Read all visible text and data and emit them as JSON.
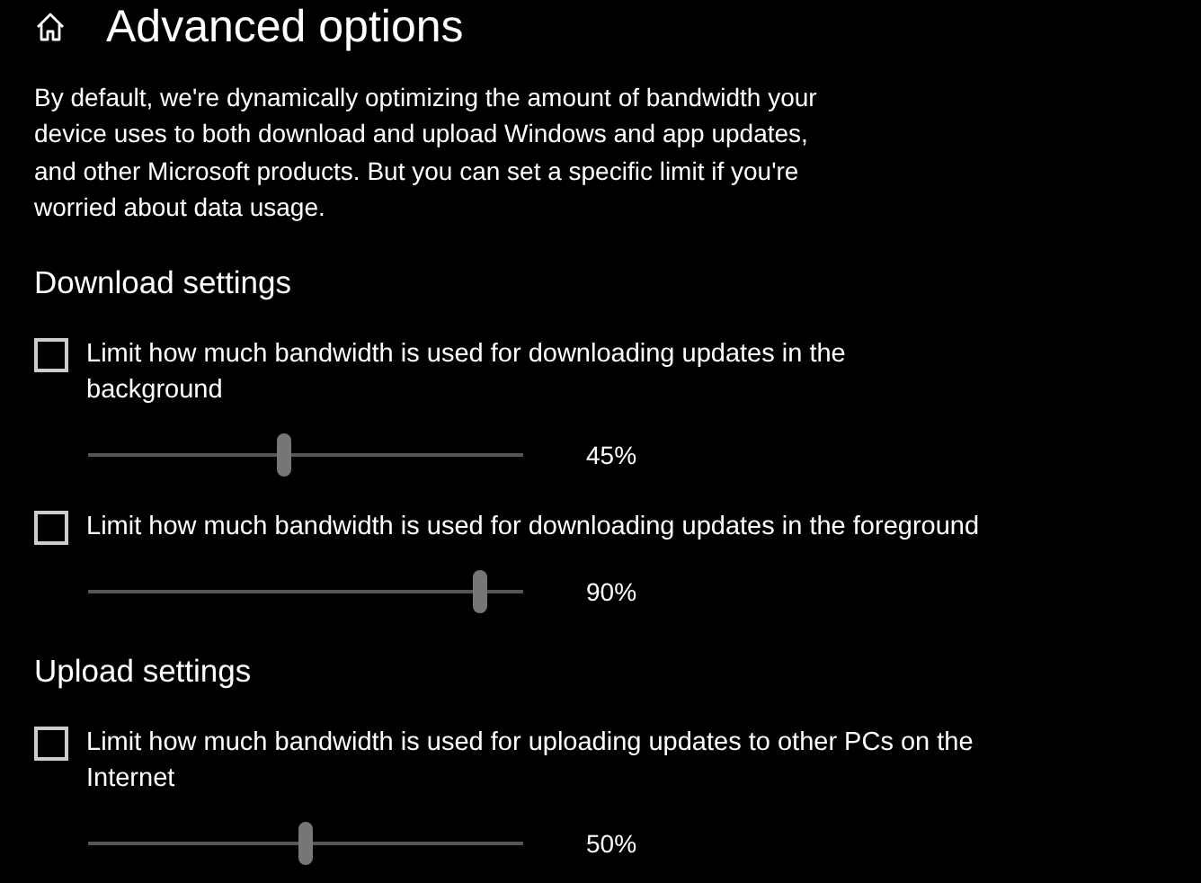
{
  "page": {
    "title": "Advanced options",
    "description": "By default, we're dynamically optimizing the amount of bandwidth your device uses to both download and upload Windows and app updates, and other Microsoft products. But you can set a specific limit if you're worried about data usage."
  },
  "sections": [
    {
      "heading": "Download settings",
      "options": [
        {
          "label": "Limit how much bandwidth is used for downloading updates in the background",
          "checked": false,
          "level": 0.45,
          "reading": "45%"
        },
        {
          "label": "Limit how much bandwidth is used for downloading updates in the foreground",
          "checked": false,
          "level": 0.9,
          "reading": "90%"
        }
      ]
    },
    {
      "heading": "Upload settings",
      "options": [
        {
          "label": "Limit how much bandwidth is used for uploading updates to other PCs on the Internet",
          "checked": false,
          "level": 0.5,
          "reading": "50%"
        }
      ]
    }
  ]
}
